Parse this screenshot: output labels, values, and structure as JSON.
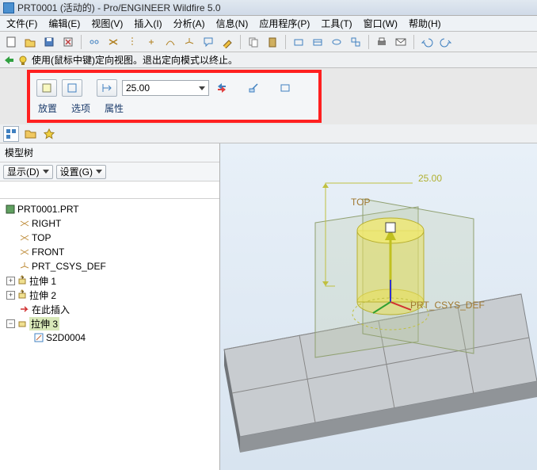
{
  "title": "PRT0001 (活动的) - Pro/ENGINEER Wildfire 5.0",
  "menu": {
    "file": "文件(F)",
    "edit": "编辑(E)",
    "view": "视图(V)",
    "insert": "插入(I)",
    "analysis": "分析(A)",
    "info": "信息(N)",
    "app": "应用程序(P)",
    "tools": "工具(T)",
    "window": "窗口(W)",
    "help": "帮助(H)"
  },
  "hint": "使用(鼠标中键)定向视图。退出定向模式以终止。",
  "depth_value": "25.00",
  "tabs": {
    "place": "放置",
    "options": "选项",
    "props": "属性"
  },
  "tree": {
    "title": "模型树",
    "show": "显示(D)",
    "settings": "设置(G)",
    "root": "PRT0001.PRT",
    "right": "RIGHT",
    "top": "TOP",
    "front": "FRONT",
    "csys": "PRT_CSYS_DEF",
    "ext1": "拉伸 1",
    "ext2": "拉伸 2",
    "inserthere": "在此插入",
    "ext3": "拉伸 3",
    "sketch": "S2D0004"
  },
  "view": {
    "dim": "25.00",
    "top": "TOP",
    "csys": "PRT_CSYS_DEF"
  }
}
